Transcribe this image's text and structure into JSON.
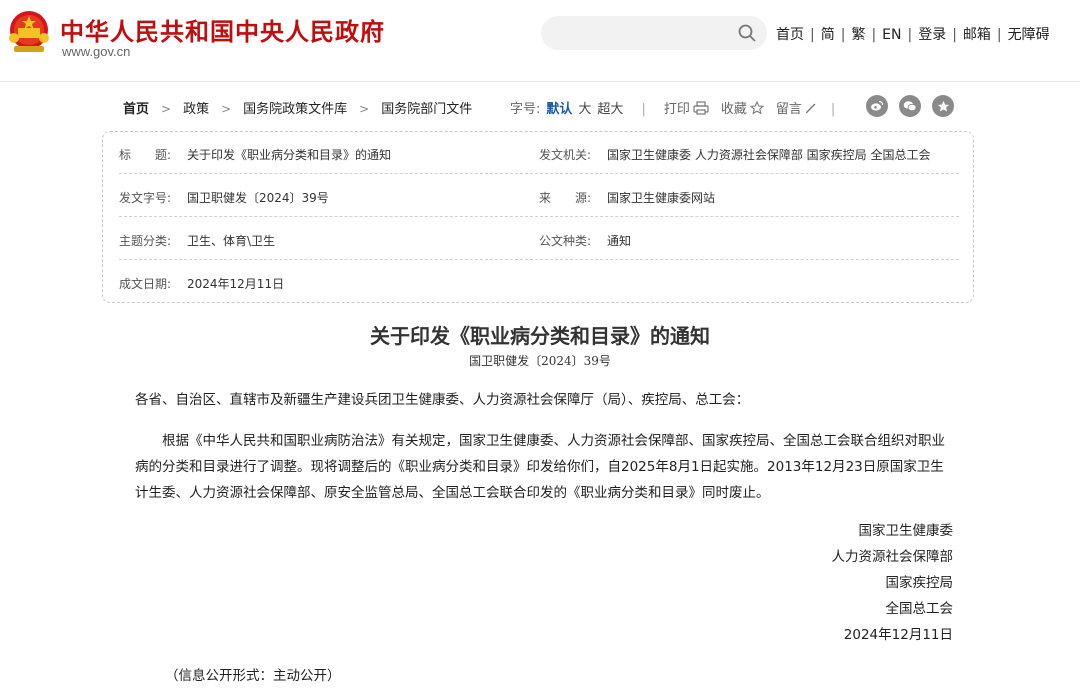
{
  "header": {
    "site_title": "中华人民共和国中央人民政府",
    "site_domain": "www.gov.cn",
    "search_placeholder": "",
    "nav": [
      "首页",
      "简",
      "繁",
      "EN",
      "登录",
      "邮箱",
      "无障碍"
    ]
  },
  "breadcrumb": [
    "首页",
    "政策",
    "国务院政策文件库",
    "国务院部门文件"
  ],
  "toolbar": {
    "font_label": "字号:",
    "font_sizes": [
      "默认",
      "大",
      "超大"
    ],
    "active_font": "默认",
    "print": "打印",
    "favorite": "收藏",
    "comment": "留言"
  },
  "info": {
    "title_label": "标　　题:",
    "title": "关于印发《职业病分类和目录》的通知",
    "issuer_label": "发文机关:",
    "issuer": "国家卫生健康委 人力资源社会保障部 国家疾控局 全国总工会",
    "doc_no_label": "发文字号:",
    "doc_no": "国卫职健发〔2024〕39号",
    "source_label": "来　　源:",
    "source": "国家卫生健康委网站",
    "topic_label": "主题分类:",
    "topic": "卫生、体育\\卫生",
    "type_label": "公文种类:",
    "type": "通知",
    "date_label": "成文日期:",
    "date": "2024年12月11日"
  },
  "article": {
    "title": "关于印发《职业病分类和目录》的通知",
    "doc_no": "国卫职健发〔2024〕39号",
    "addressee": "各省、自治区、直辖市及新疆生产建设兵团卫生健康委、人力资源社会保障厅（局）、疾控局、总工会：",
    "body": "根据《中华人民共和国职业病防治法》有关规定，国家卫生健康委、人力资源社会保障部、国家疾控局、全国总工会联合组织对职业病的分类和目录进行了调整。现将调整后的《职业病分类和目录》印发给你们，自2025年8月1日起实施。2013年12月23日原国家卫生计生委、人力资源社会保障部、原安全监管总局、全国总工会联合印发的《职业病分类和目录》同时废止。",
    "signers": [
      "国家卫生健康委",
      "人力资源社会保障部",
      "国家疾控局",
      "全国总工会"
    ],
    "sign_date": "2024年12月11日",
    "disclosure": "（信息公开形式：主动公开）"
  },
  "colors": {
    "brand_red": "#c00e0e",
    "active_blue": "#1a5aa6",
    "share_gray": "#8a8a8a"
  },
  "icons": [
    "national-emblem-icon",
    "search-icon",
    "print-icon",
    "star-icon",
    "pen-icon",
    "weibo-icon",
    "wechat-icon",
    "share-icon"
  ]
}
